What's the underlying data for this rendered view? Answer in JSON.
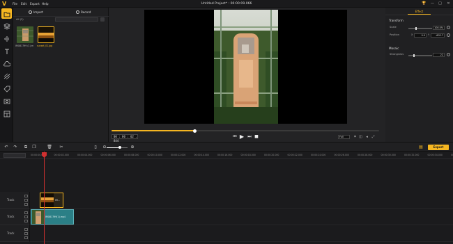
{
  "menubar": {
    "logo": "V",
    "menus": [
      "File",
      "Edit",
      "Export",
      "Help"
    ],
    "title": "Untitled Project*  :  00:00:09.066",
    "window_controls": [
      "🏆",
      "—",
      "□",
      "✕"
    ]
  },
  "toolstrip": {
    "tools": [
      "media-tool",
      "layers-tool",
      "audio-tool",
      "text-tool",
      "filter-tool",
      "transition-tool",
      "sticker-tool",
      "camera-tool",
      "template-tool"
    ],
    "active_index": 0,
    "accent": "#f5b621"
  },
  "media": {
    "import_label": "Import",
    "record_label": "Record",
    "filter_label": "All (2)",
    "items": [
      {
        "name": "IMG61799 (1).mp4"
      },
      {
        "name": "sunset_01.jpg"
      }
    ]
  },
  "preview": {
    "timecode": "00 : 00 : 02 . 844",
    "progress": 0.31,
    "fit_label": "Full"
  },
  "properties": {
    "tab": "Effect",
    "transform_heading": "Transform",
    "scale_label": "Scale",
    "scale_value": "100.0%",
    "position_label": "Position",
    "position_x": "0.0",
    "position_y": "-602.7",
    "mosaic_heading": "Mosaic",
    "strength_label": "Strongness",
    "strength_value": "22"
  },
  "timeline": {
    "export_label": "Export",
    "ruler": [
      "00:00:00.000",
      "00:00:02.000",
      "00:00:04.000",
      "00:00:06.000",
      "00:00:08.000",
      "00:00:10.000",
      "00:00:12.000",
      "00:00:14.000",
      "00:00:16.000",
      "00:00:18.000",
      "00:00:20.000",
      "00:00:22.000",
      "00:00:24.000",
      "00:00:26.000",
      "00:00:28.000",
      "00:00:30.000",
      "00:00:32.000",
      "00:00:34.000",
      "00:00:36.000"
    ],
    "tracks": [
      {
        "label": "Track"
      },
      {
        "label": "Track"
      },
      {
        "label": "Track"
      }
    ],
    "clips": {
      "image_clip_label": "IM...",
      "video_clip_label": "IMG61799(1).mp4"
    }
  }
}
